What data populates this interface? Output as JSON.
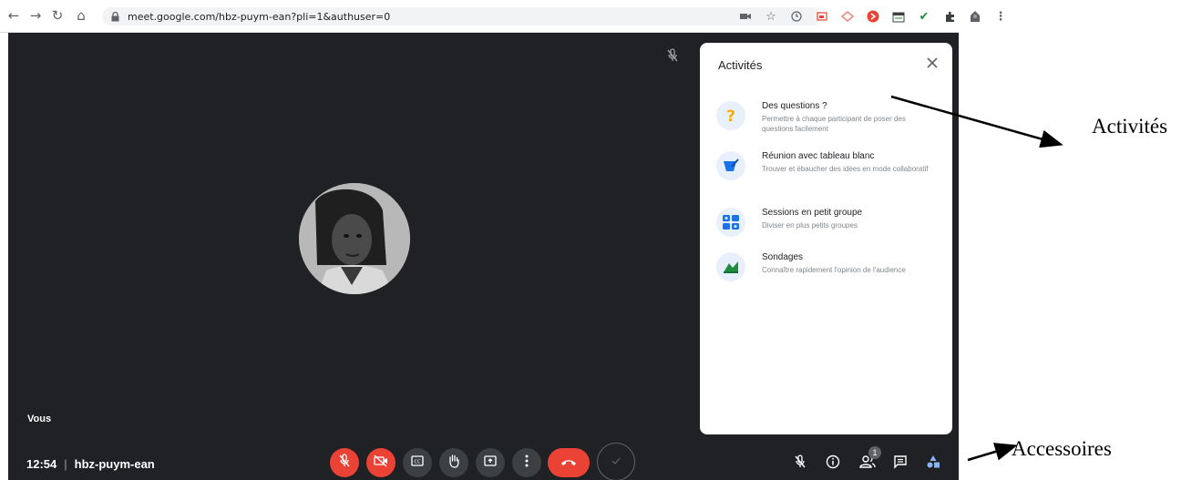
{
  "browser": {
    "url": "meet.google.com/hbz-puym-ean?pli=1&authuser=0",
    "nav_icons": [
      "back-icon",
      "forward-icon",
      "reload-icon",
      "home-icon"
    ],
    "extension_icons": [
      "camera-icon",
      "star-icon",
      "history-icon",
      "cast-icon",
      "extension-icon",
      "extension-icon",
      "extension-icon",
      "check-icon",
      "puzzle-icon",
      "profile-icon",
      "menu-icon"
    ]
  },
  "meeting": {
    "self_label": "Vous",
    "time": "12:54",
    "separator": "|",
    "code": "hbz-puym-ean",
    "colors": {
      "background": "#202124",
      "danger": "#ea4335",
      "control": "#3c4043"
    }
  },
  "toolbar": {
    "controls": [
      "microphone-off-icon",
      "camera-off-icon",
      "captions-icon",
      "raise-hand-icon",
      "present-icon",
      "more-options-icon",
      "end-call-icon",
      "check-icon"
    ],
    "accessories": [
      "microphone-off-icon",
      "info-icon",
      "people-icon",
      "chat-icon",
      "activities-icon"
    ],
    "participant_count": "1"
  },
  "activities_panel": {
    "title": "Activités",
    "items": [
      {
        "title": "Des questions ?",
        "description": "Permettre à chaque participant de poser des questions facilement",
        "icon": "question-icon"
      },
      {
        "title": "Réunion avec tableau blanc",
        "description": "Trouver et ébaucher des idées en mode collaboratif",
        "icon": "whiteboard-icon"
      },
      {
        "title": "Sessions en petit groupe",
        "description": "Diviser en plus petits groupes",
        "icon": "breakout-rooms-icon"
      },
      {
        "title": "Sondages",
        "description": "Connaître rapidement l'opinion de l'audience",
        "icon": "polls-icon"
      }
    ]
  },
  "annotations": {
    "activities": "Activités",
    "accessories": "Accessoires"
  }
}
